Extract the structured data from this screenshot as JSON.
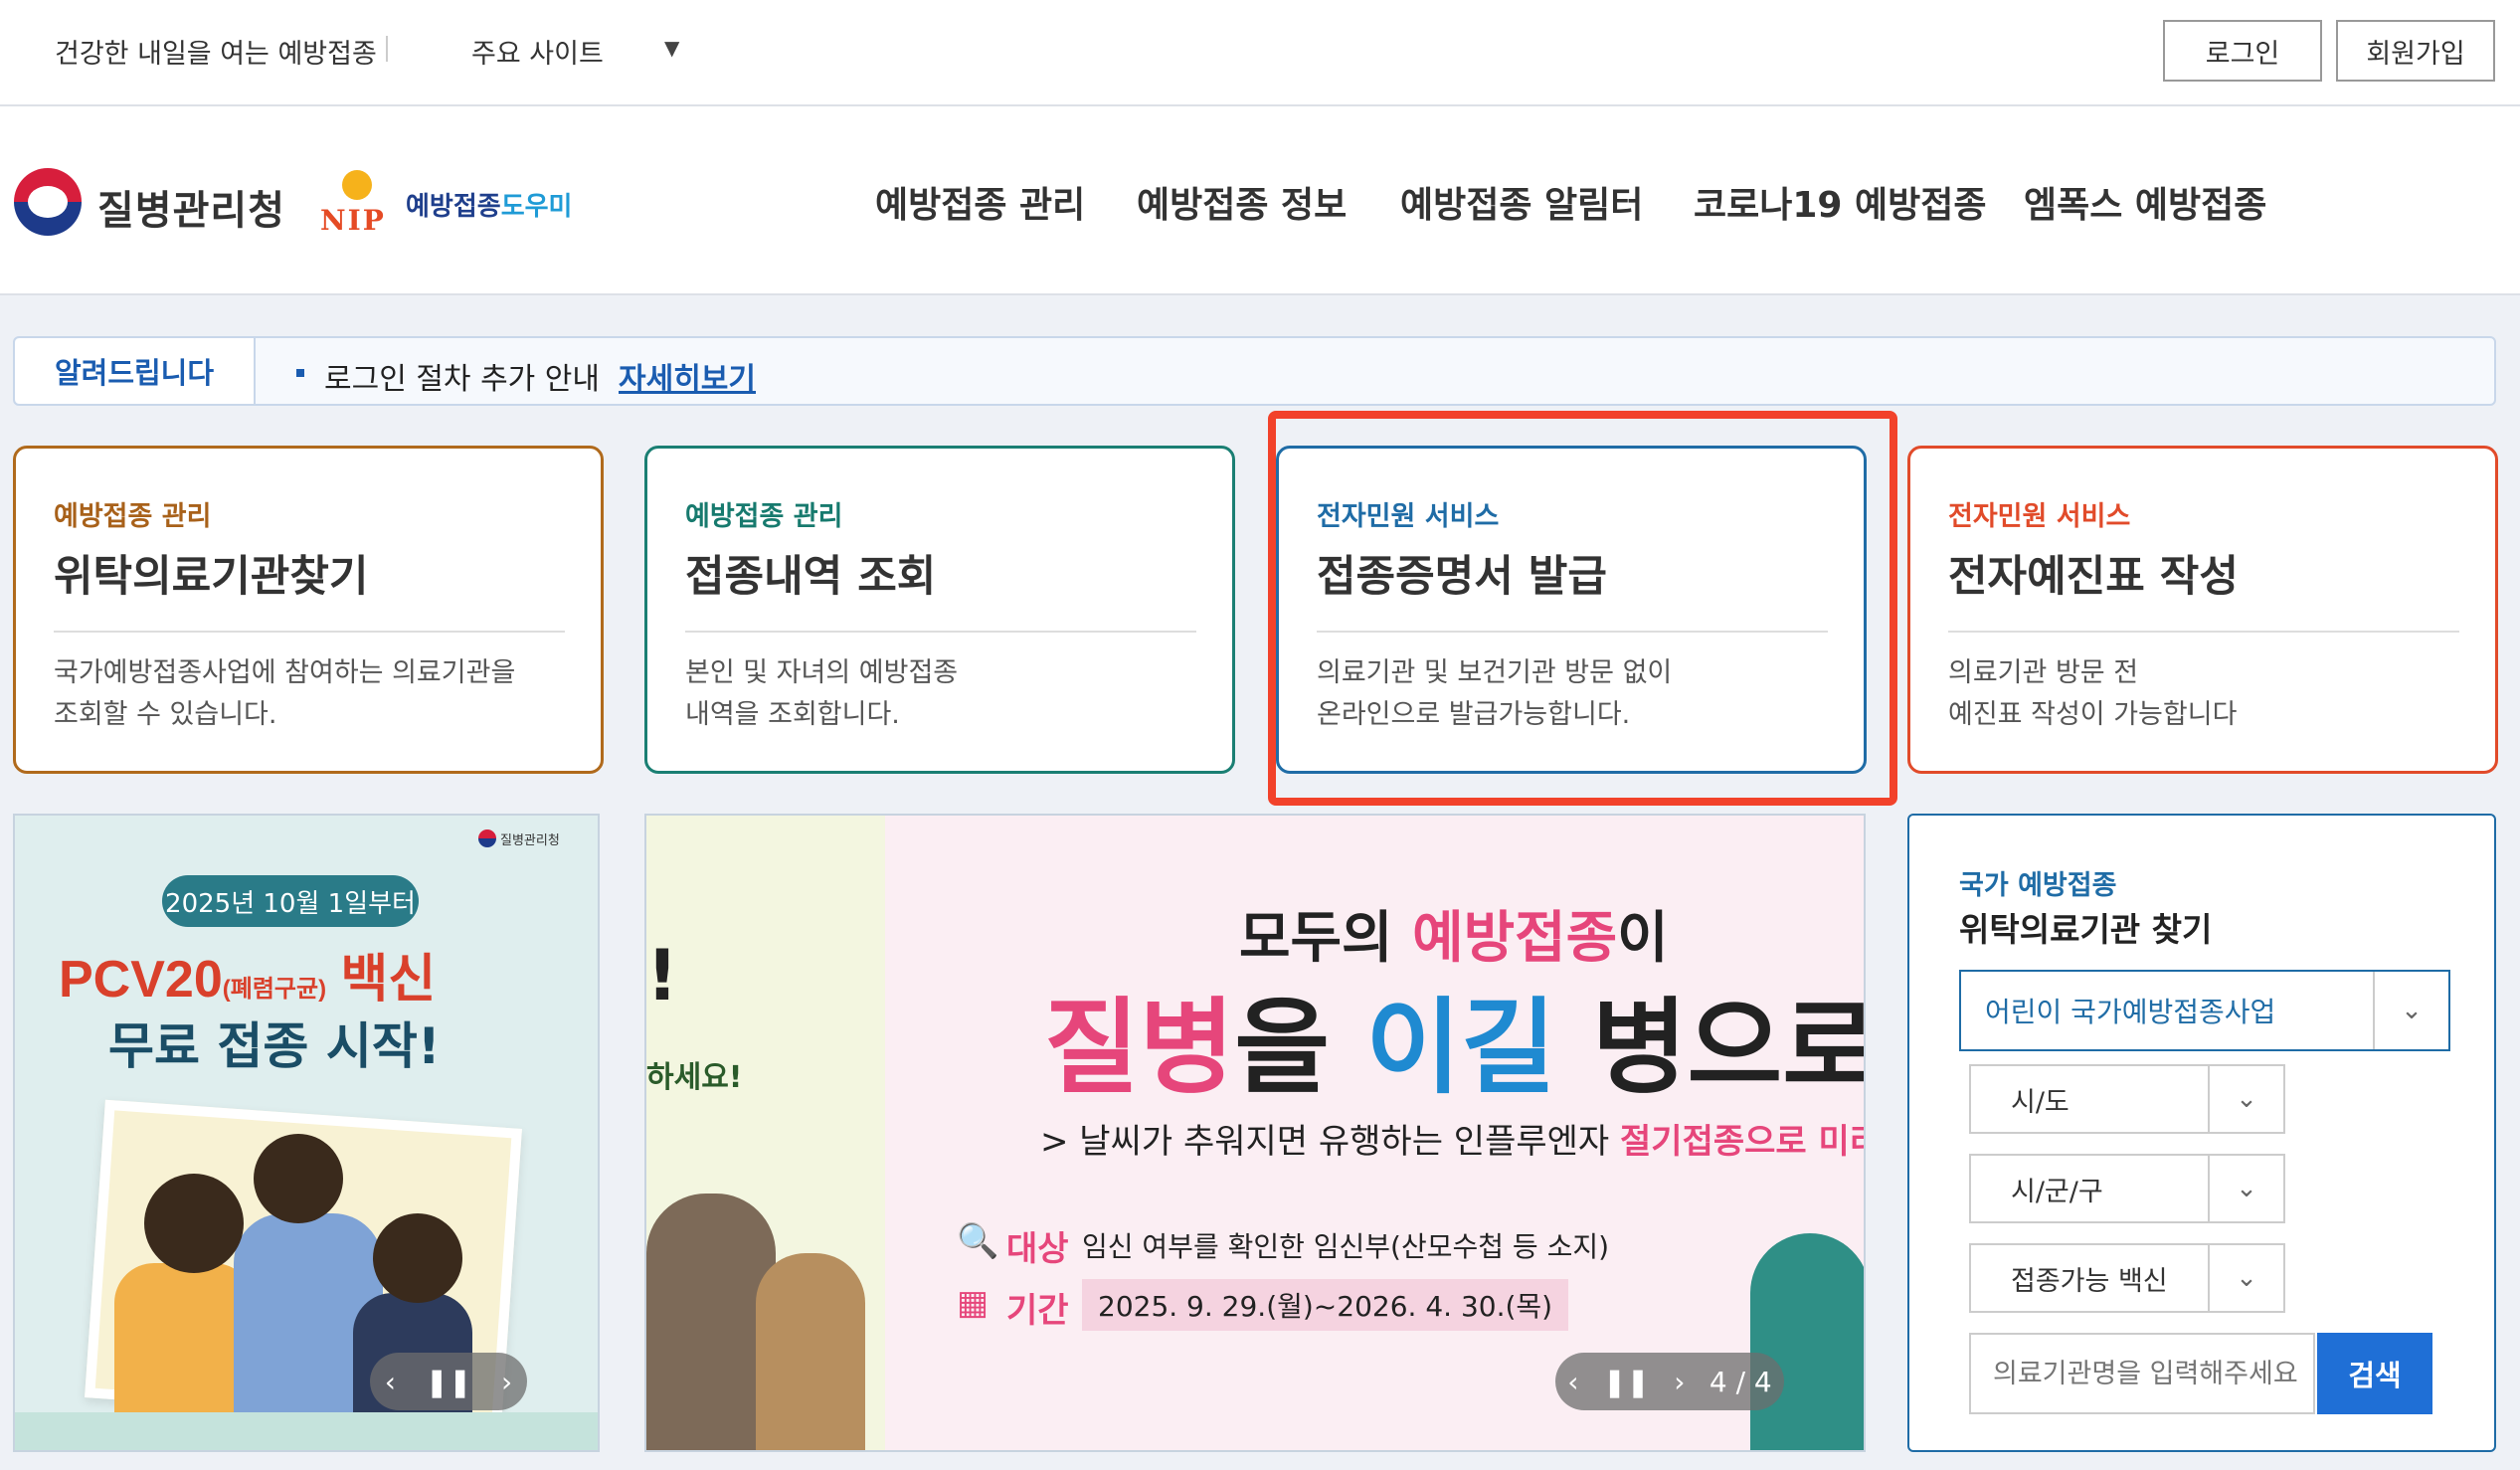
{
  "topbar": {
    "tagline": "건강한 내일을 여는 예방접종",
    "major_sites": "주요 사이트",
    "login": "로그인",
    "signup": "회원가입"
  },
  "header": {
    "agency_name": "질병관리청",
    "nip_logo_text": "NIP",
    "nip_name_a": "예방접종",
    "nip_name_b": "도우미",
    "nav": [
      "예방접종 관리",
      "예방접종 정보",
      "예방접종 알림터",
      "코로나19 예방접종",
      "엠폭스 예방접종"
    ]
  },
  "notice": {
    "label": "알려드립니다",
    "text": "로그인 절차 추가 안내",
    "link": "자세히보기"
  },
  "cards": [
    {
      "category": "예방접종 관리",
      "title": "위탁의료기관찾기",
      "desc1": "국가예방접종사업에 참여하는 의료기관을",
      "desc2": "조회할 수 있습니다."
    },
    {
      "category": "예방접종 관리",
      "title": "접종내역 조회",
      "desc1": "본인 및 자녀의 예방접종",
      "desc2": "내역을 조회합니다."
    },
    {
      "category": "전자민원 서비스",
      "title": "접종증명서 발급",
      "desc1": "의료기관 및 보건기관 방문 없이",
      "desc2": "온라인으로 발급가능합니다."
    },
    {
      "category": "전자민원 서비스",
      "title": "전자예진표 작성",
      "desc1": "의료기관 방문 전",
      "desc2": "예진표 작성이 가능합니다"
    }
  ],
  "banner1": {
    "brand": "질병관리청",
    "date_pill": "2025년 10월 1일부터",
    "headline_a": "PCV20",
    "headline_small": "(폐렴구균)",
    "headline_b": " 백신",
    "headline2": "무료 접종 시작!"
  },
  "banner2": {
    "left_fragment": "하세요!",
    "h1_a": "모두의 ",
    "h1_pink": "예방접종",
    "h1_b": "이",
    "h2_pink": "질병",
    "h2_a": "을 ",
    "h2_blue": "이길",
    "h2_b": " 병으로",
    "sub_a": "날씨가 추워지면 유행하는 인플루엔자 ",
    "sub_pink": "절기접종으로 미리 예방하",
    "target_label": "대상",
    "target_value": "임신 여부를 확인한 임신부(산모수첩 등 소지)",
    "period_label": "기간",
    "period_value": "2025. 9. 29.(월)~2026. 4. 30.(목)",
    "slide_counter": "4 / 4"
  },
  "finder": {
    "category": "국가 예방접종",
    "title": "위탁의료기관 찾기",
    "program_select": "어린이 국가예방접종사업",
    "sido": "시/도",
    "sigungu": "시/군/구",
    "vaccine": "접종가능 백신",
    "search_placeholder": "의료기관명을 입력해주세요",
    "search_button": "검색"
  },
  "colors": {
    "brand_blue": "#1f6ca6",
    "highlight_red": "#f2422a",
    "search_blue": "#1f6fd6"
  }
}
